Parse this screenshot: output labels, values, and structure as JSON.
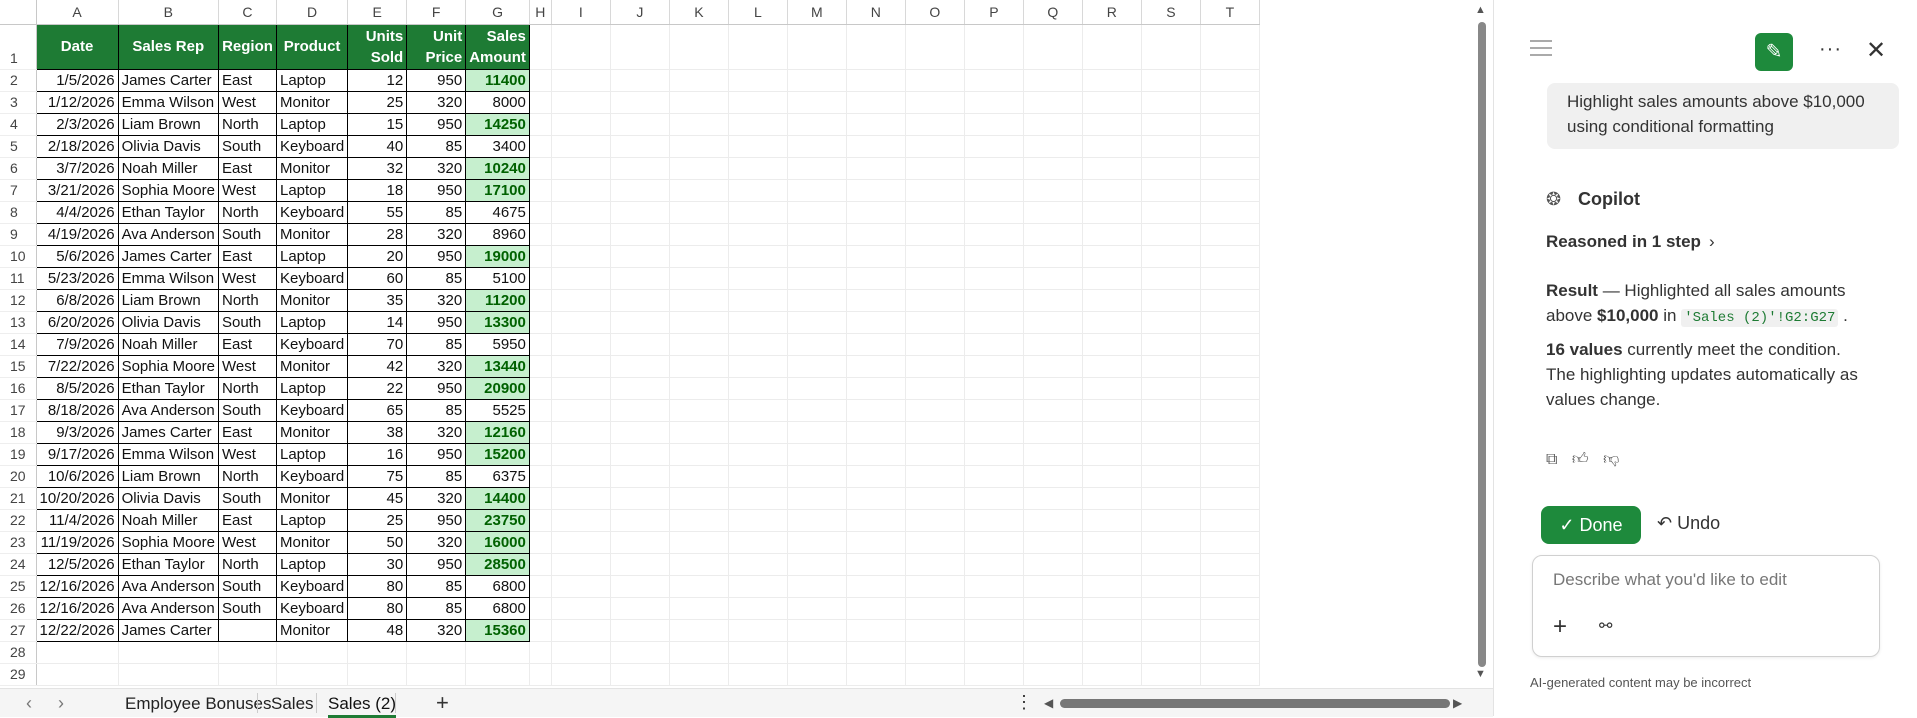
{
  "columns": [
    "A",
    "B",
    "C",
    "D",
    "E",
    "F",
    "G",
    "H",
    "I",
    "J",
    "K",
    "L",
    "M",
    "N",
    "O",
    "P",
    "Q",
    "R",
    "S",
    "T"
  ],
  "headers": {
    "date": "Date",
    "rep": "Sales Rep",
    "region": "Region",
    "product": "Product",
    "units": "Units Sold",
    "price": "Unit Price",
    "amount": "Sales Amount"
  },
  "rows": [
    [
      "1/5/2026",
      "James Carter",
      "East",
      "Laptop",
      "12",
      "950",
      "11400",
      true
    ],
    [
      "1/12/2026",
      "Emma Wilson",
      "West",
      "Monitor",
      "25",
      "320",
      "8000",
      false
    ],
    [
      "2/3/2026",
      "Liam Brown",
      "North",
      "Laptop",
      "15",
      "950",
      "14250",
      true
    ],
    [
      "2/18/2026",
      "Olivia Davis",
      "South",
      "Keyboard",
      "40",
      "85",
      "3400",
      false
    ],
    [
      "3/7/2026",
      "Noah Miller",
      "East",
      "Monitor",
      "32",
      "320",
      "10240",
      true
    ],
    [
      "3/21/2026",
      "Sophia Moore",
      "West",
      "Laptop",
      "18",
      "950",
      "17100",
      true
    ],
    [
      "4/4/2026",
      "Ethan Taylor",
      "North",
      "Keyboard",
      "55",
      "85",
      "4675",
      false
    ],
    [
      "4/19/2026",
      "Ava Anderson",
      "South",
      "Monitor",
      "28",
      "320",
      "8960",
      false
    ],
    [
      "5/6/2026",
      "James Carter",
      "East",
      "Laptop",
      "20",
      "950",
      "19000",
      true
    ],
    [
      "5/23/2026",
      "Emma Wilson",
      "West",
      "Keyboard",
      "60",
      "85",
      "5100",
      false
    ],
    [
      "6/8/2026",
      "Liam Brown",
      "North",
      "Monitor",
      "35",
      "320",
      "11200",
      true
    ],
    [
      "6/20/2026",
      "Olivia Davis",
      "South",
      "Laptop",
      "14",
      "950",
      "13300",
      true
    ],
    [
      "7/9/2026",
      "Noah Miller",
      "East",
      "Keyboard",
      "70",
      "85",
      "5950",
      false
    ],
    [
      "7/22/2026",
      "Sophia Moore",
      "West",
      "Monitor",
      "42",
      "320",
      "13440",
      true
    ],
    [
      "8/5/2026",
      "Ethan Taylor",
      "North",
      "Laptop",
      "22",
      "950",
      "20900",
      true
    ],
    [
      "8/18/2026",
      "Ava Anderson",
      "South",
      "Keyboard",
      "65",
      "85",
      "5525",
      false
    ],
    [
      "9/3/2026",
      "James Carter",
      "East",
      "Monitor",
      "38",
      "320",
      "12160",
      true
    ],
    [
      "9/17/2026",
      "Emma Wilson",
      "West",
      "Laptop",
      "16",
      "950",
      "15200",
      true
    ],
    [
      "10/6/2026",
      "Liam Brown",
      "North",
      "Keyboard",
      "75",
      "85",
      "6375",
      false
    ],
    [
      "10/20/2026",
      "Olivia Davis",
      "South",
      "Monitor",
      "45",
      "320",
      "14400",
      true
    ],
    [
      "11/4/2026",
      "Noah Miller",
      "East",
      "Laptop",
      "25",
      "950",
      "23750",
      true
    ],
    [
      "11/19/2026",
      "Sophia Moore",
      "West",
      "Monitor",
      "50",
      "320",
      "16000",
      true
    ],
    [
      "12/5/2026",
      "Ethan Taylor",
      "North",
      "Laptop",
      "30",
      "950",
      "28500",
      true
    ],
    [
      "12/16/2026",
      "Ava Anderson",
      "South",
      "Keyboard",
      "80",
      "85",
      "6800",
      false
    ],
    [
      "12/16/2026",
      "Ava Anderson",
      "South",
      "Keyboard",
      "80",
      "85",
      "6800",
      false
    ],
    [
      "12/22/2026",
      "James Carter",
      "",
      "Monitor",
      "48",
      "320",
      "15360",
      true
    ]
  ],
  "extra_rows": [
    "28",
    "29"
  ],
  "tabs": {
    "items": [
      "Employee Bonuses",
      "Sales",
      "Sales (2)"
    ],
    "active": "Sales (2)",
    "add": "+",
    "prev": "‹",
    "next": "›",
    "more": "⋮"
  },
  "panel": {
    "user_message": "Highlight sales amounts above $10,000 using conditional formatting",
    "assistant_name": "Copilot",
    "reasoned": "Reasoned in 1 step",
    "result_label": "Result",
    "result_text_1": " — Highlighted all sales amounts above ",
    "result_threshold": "$10,000",
    "result_text_2": " in ",
    "result_range": "'Sales (2)'!G2:G27",
    "result_text_3": " .",
    "count_bold": "16 values",
    "count_text": " currently meet the condition. The highlighting updates automatically as values change.",
    "done_label": "Done",
    "undo_label": "Undo",
    "input_placeholder": "Describe what you'd like to edit",
    "disclaimer": "AI-generated content may be incorrect"
  },
  "colors": {
    "header_fill": "#1e7b34",
    "highlight_fill": "#c6efce",
    "highlight_text": "#006100",
    "accent": "#1e8a3c"
  },
  "icons": {
    "menu": "menu-icon",
    "edit": "edit-icon",
    "more": "more-icon",
    "close": "close-icon",
    "copilot": "copilot-icon",
    "copy": "copy-icon",
    "thumbs_up": "thumbs-up-icon",
    "thumbs_down": "thumbs-down-icon",
    "check": "check-icon",
    "undo": "undo-icon",
    "plus": "plus-icon",
    "link": "link-icon"
  }
}
